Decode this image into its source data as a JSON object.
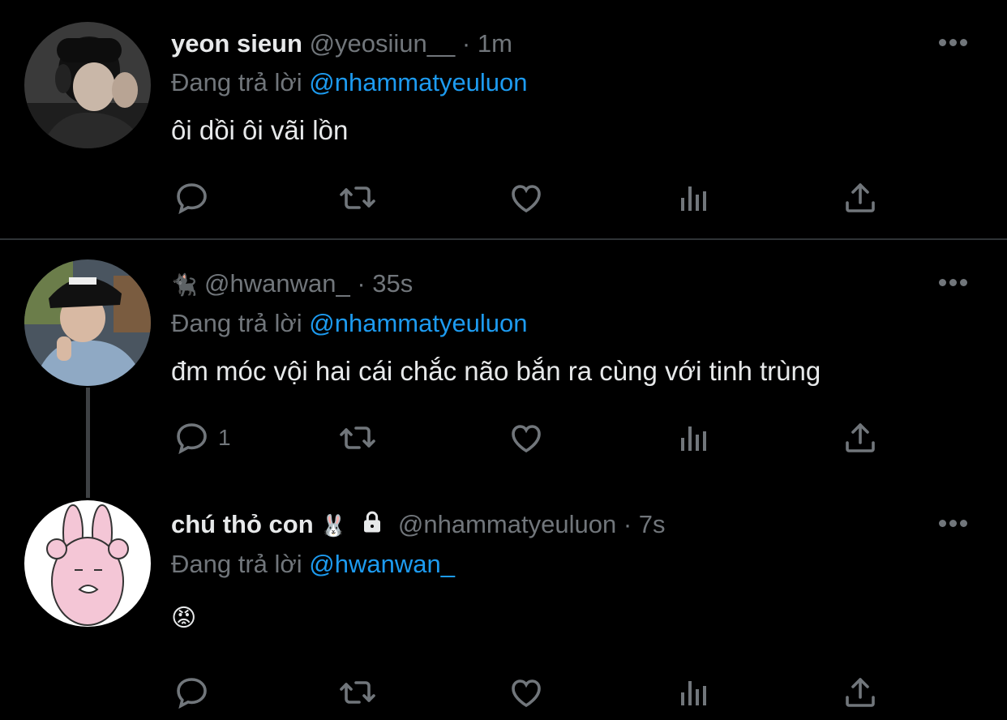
{
  "tweets": [
    {
      "name": "yeon sieun",
      "handle": "@yeosiiun__",
      "dot": "·",
      "time": "1m",
      "reply_prefix": "Đang trả lời",
      "reply_to": "@nhammatyeuluon",
      "text": "ôi dồi ôi vãi lồn",
      "reply_count": ""
    },
    {
      "name": "",
      "name_emoji": "🐈‍⬛",
      "handle": "@hwanwan_",
      "dot": "·",
      "time": "35s",
      "reply_prefix": "Đang trả lời",
      "reply_to": "@nhammatyeuluon",
      "text": "đm móc vội hai cái chắc não bắn ra cùng với tinh trùng",
      "reply_count": "1"
    },
    {
      "name": "chú thỏ con",
      "name_emoji": "🐰",
      "handle": "@nhammatyeuluon",
      "dot": "·",
      "time": "7s",
      "reply_prefix": "Đang trả lời",
      "reply_to": "@hwanwan_",
      "text": "😡",
      "reply_count": ""
    }
  ],
  "colors": {
    "background": "#000000",
    "text": "#e7e9ea",
    "muted": "#71767b",
    "link": "#1d9bf0",
    "divider": "#2f3336"
  },
  "icons": [
    "reply-icon",
    "retweet-icon",
    "like-icon",
    "views-icon",
    "share-icon",
    "more-icon",
    "lock-icon"
  ]
}
